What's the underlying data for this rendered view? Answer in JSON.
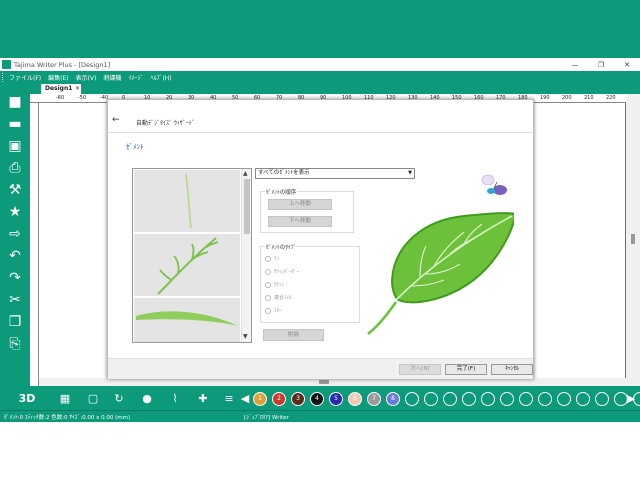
{
  "window": {
    "title": "Tajima Writer Plus - [Design1]",
    "controls": [
      "—",
      "❐",
      "✕"
    ]
  },
  "menu": [
    "ファイル(F)",
    "編集(E)",
    "表示(V)",
    "刺繍機",
    "ｲﾒｰｼﾞ",
    "ﾍﾙﾌﾟ(H)"
  ],
  "document_tab": {
    "label": "Design1",
    "close": "×"
  },
  "ruler_ticks": [
    "-60",
    "-50",
    "-40",
    "0",
    "10",
    "20",
    "30",
    "40",
    "50",
    "60",
    "70",
    "80",
    "90",
    "100",
    "110",
    "120",
    "130",
    "140",
    "150",
    "160",
    "170",
    "180",
    "190",
    "200",
    "210",
    "220"
  ],
  "left_tools": [
    {
      "icon": "new-document-icon",
      "glyph": "■"
    },
    {
      "icon": "open-folder-icon",
      "glyph": "▬"
    },
    {
      "icon": "save-icon",
      "glyph": "▣"
    },
    {
      "icon": "print-icon",
      "glyph": "⎙"
    },
    {
      "icon": "sewing-machine-icon",
      "glyph": "⚒"
    },
    {
      "icon": "favorite-star-icon",
      "glyph": "★"
    },
    {
      "icon": "send-to-machine-icon",
      "glyph": "⇨"
    },
    {
      "icon": "undo-icon",
      "glyph": "↶"
    },
    {
      "icon": "redo-icon",
      "glyph": "↷"
    },
    {
      "icon": "cut-icon",
      "glyph": "✂"
    },
    {
      "icon": "copy-icon",
      "glyph": "❐"
    },
    {
      "icon": "paste-icon",
      "glyph": "⎘"
    }
  ],
  "bottom_tools": {
    "view_3d": "3D",
    "icons": [
      "grid-icon",
      "hoop-icon",
      "rotate-icon",
      "ball-icon",
      "stitch-icon",
      "cross-icon",
      "list-icon",
      "prev-color-icon"
    ],
    "swatches": [
      {
        "label": "1",
        "color": "#d9a23a"
      },
      {
        "label": "2",
        "color": "#c83a2e"
      },
      {
        "label": "3",
        "color": "#5a2a1a"
      },
      {
        "label": "4",
        "color": "#111111"
      },
      {
        "label": "5",
        "color": "#2a2ab0"
      },
      {
        "label": "6",
        "color": "#f3c7b0"
      },
      {
        "label": "7",
        "color": "#9a9a9a"
      },
      {
        "label": "8",
        "color": "#6a7ad8"
      }
    ],
    "empty_swatch_count": 17,
    "next_color_icon": "▶"
  },
  "status": {
    "left": "ｾﾞﾒﾝﾄ:0 ｽﾃｨｯﾁ数:2 色数:0 ｻｲｽﾞ:0.00 x 0.00 (mm)",
    "right": "[ｼﾞｭﾌﾞﾛﾘｱ] Writer"
  },
  "dialog": {
    "back_icon": "←",
    "title": "自動ﾃﾞｼﾞﾀｲｽﾞ ｳｨｻﾞｰﾄﾞ",
    "heading": "ｾﾞﾒﾝﾄ",
    "segment_filter": "すべてのｾﾞﾒﾝﾄを表示",
    "order_group": {
      "label": "ｾﾞﾒﾝﾄの順序",
      "move_up": "上へ移動",
      "move_down": "下へ移動"
    },
    "type_group": {
      "label": "ｾﾞﾒﾝﾄのﾀｲﾌﾟ",
      "options": [
        "ﾗﾝ",
        "ｻﾃｨﾝﾎﾞｰﾀﾞｰ",
        "ｻﾃｨﾝ",
        "複合ﾌｨﾙ",
        "ｽﾀｰ"
      ]
    },
    "delete": "削除",
    "footer": {
      "next": "次へ(N)",
      "finish": "完了(F)",
      "cancel": "ｷｬﾝｾﾙ"
    },
    "colors": {
      "heading": "#1d57c9",
      "leaf_dark": "#3f9b1c",
      "leaf_light": "#6dc13a",
      "vein": "#d9efc6"
    }
  },
  "accent_color": "#0c9a7a"
}
